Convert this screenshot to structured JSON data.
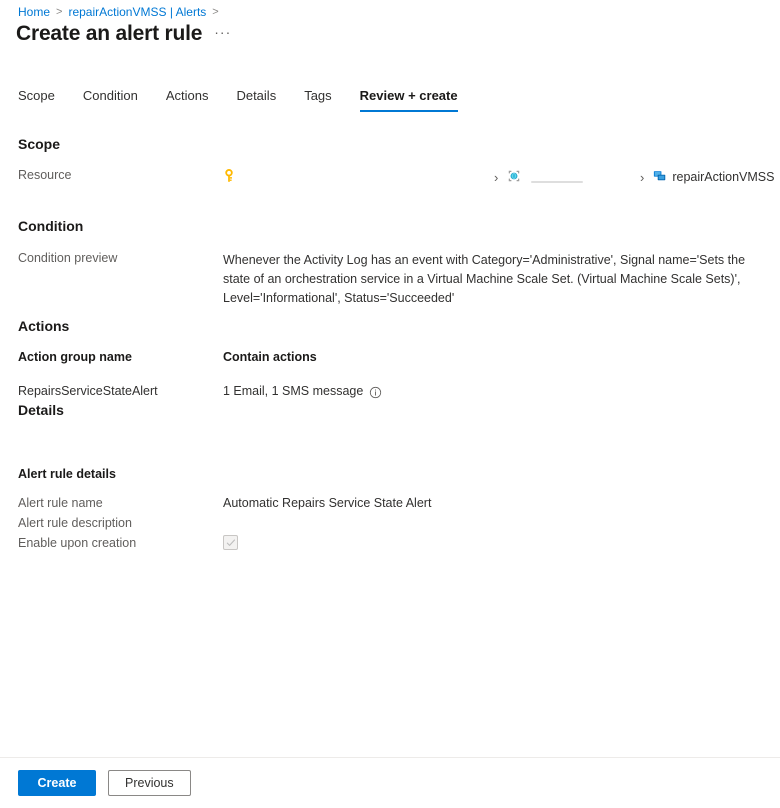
{
  "breadcrumb": {
    "items": [
      {
        "label": "Home",
        "icon": ""
      },
      {
        "label": "repairActionVMSS | Alerts",
        "icon": ""
      }
    ],
    "separator": ">"
  },
  "header": {
    "title": "Create an alert rule",
    "ellipsis": "···"
  },
  "tabs": [
    {
      "label": "Scope",
      "active": false
    },
    {
      "label": "Condition",
      "active": false
    },
    {
      "label": "Actions",
      "active": false
    },
    {
      "label": "Details",
      "active": false
    },
    {
      "label": "Tags",
      "active": false
    },
    {
      "label": "Review + create",
      "active": true
    }
  ],
  "scope": {
    "heading": "Scope",
    "resource_label": "Resource",
    "chain": [
      {
        "icon": "subscription-key-icon",
        "label": ""
      },
      {
        "icon": "resource-group-icon",
        "label": ""
      },
      {
        "icon": "vmss-icon",
        "label": "repairActionVMSS"
      }
    ],
    "chevron": "›"
  },
  "condition": {
    "heading": "Condition",
    "preview_label": "Condition preview",
    "preview_text": "Whenever the Activity Log has an event with Category='Administrative', Signal name='Sets the state of an orchestration service in a Virtual Machine Scale Set. (Virtual Machine Scale Sets)', Level='Informational', Status='Succeeded'"
  },
  "actions": {
    "heading": "Actions",
    "columns": [
      "Action group name",
      "Contain actions"
    ],
    "rows": [
      {
        "action_group_name": "RepairsServiceStateAlert",
        "contain_actions": "1 Email, 1 SMS message"
      }
    ],
    "info_icon": "info-icon"
  },
  "details": {
    "heading": "Details",
    "subheading": "Alert rule details",
    "fields": [
      {
        "label": "Alert rule name",
        "value": "Automatic Repairs Service State Alert"
      },
      {
        "label": "Alert rule description",
        "value": ""
      },
      {
        "label": "Enable upon creation",
        "value": "",
        "type": "checkbox",
        "checked": true,
        "disabled": true
      }
    ]
  },
  "footer": {
    "create_label": "Create",
    "previous_label": "Previous"
  },
  "colors": {
    "accent": "#0078d4",
    "link": "#0078d4",
    "text": "#323130",
    "muted": "#605e5c",
    "subscription_icon": "#ffb900",
    "resource_group_icon": "#32bedd",
    "vmss_icon": "#0078d4"
  }
}
